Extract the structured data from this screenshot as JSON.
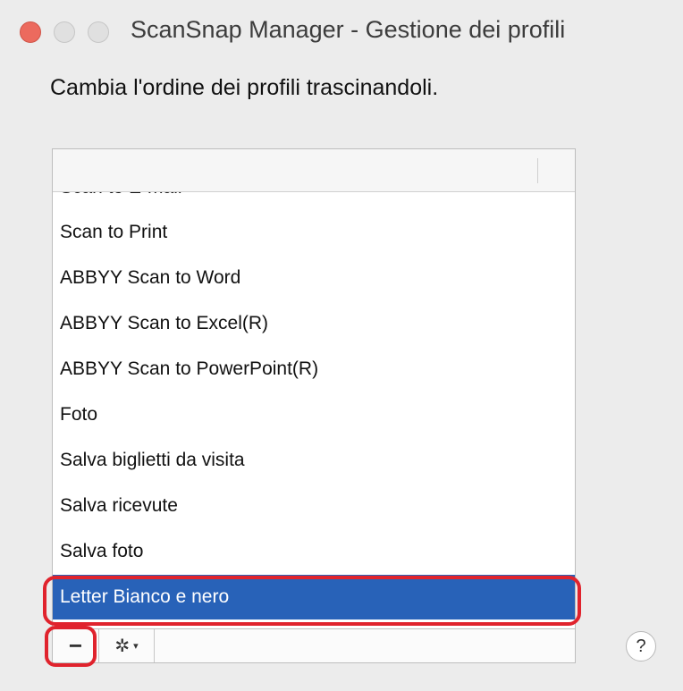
{
  "window": {
    "title": "ScanSnap Manager - Gestione dei profili"
  },
  "instruction": "Cambia l'ordine dei profili trascinandoli.",
  "profile_list": {
    "items": [
      "Scan to E-mail",
      "Scan to Print",
      "ABBYY Scan to Word",
      "ABBYY Scan to Excel(R)",
      "ABBYY Scan to PowerPoint(R)",
      "Foto",
      "Salva biglietti da visita",
      "Salva ricevute",
      "Salva foto",
      "Letter Bianco e nero"
    ],
    "selected": "Letter Bianco e nero"
  },
  "toolbar": {
    "minus_label": "−",
    "gear_label": "✲",
    "gear_caret": "▾"
  },
  "help": {
    "label": "?"
  },
  "colors": {
    "selection": "#2862b8",
    "highlight": "#e0232d"
  }
}
